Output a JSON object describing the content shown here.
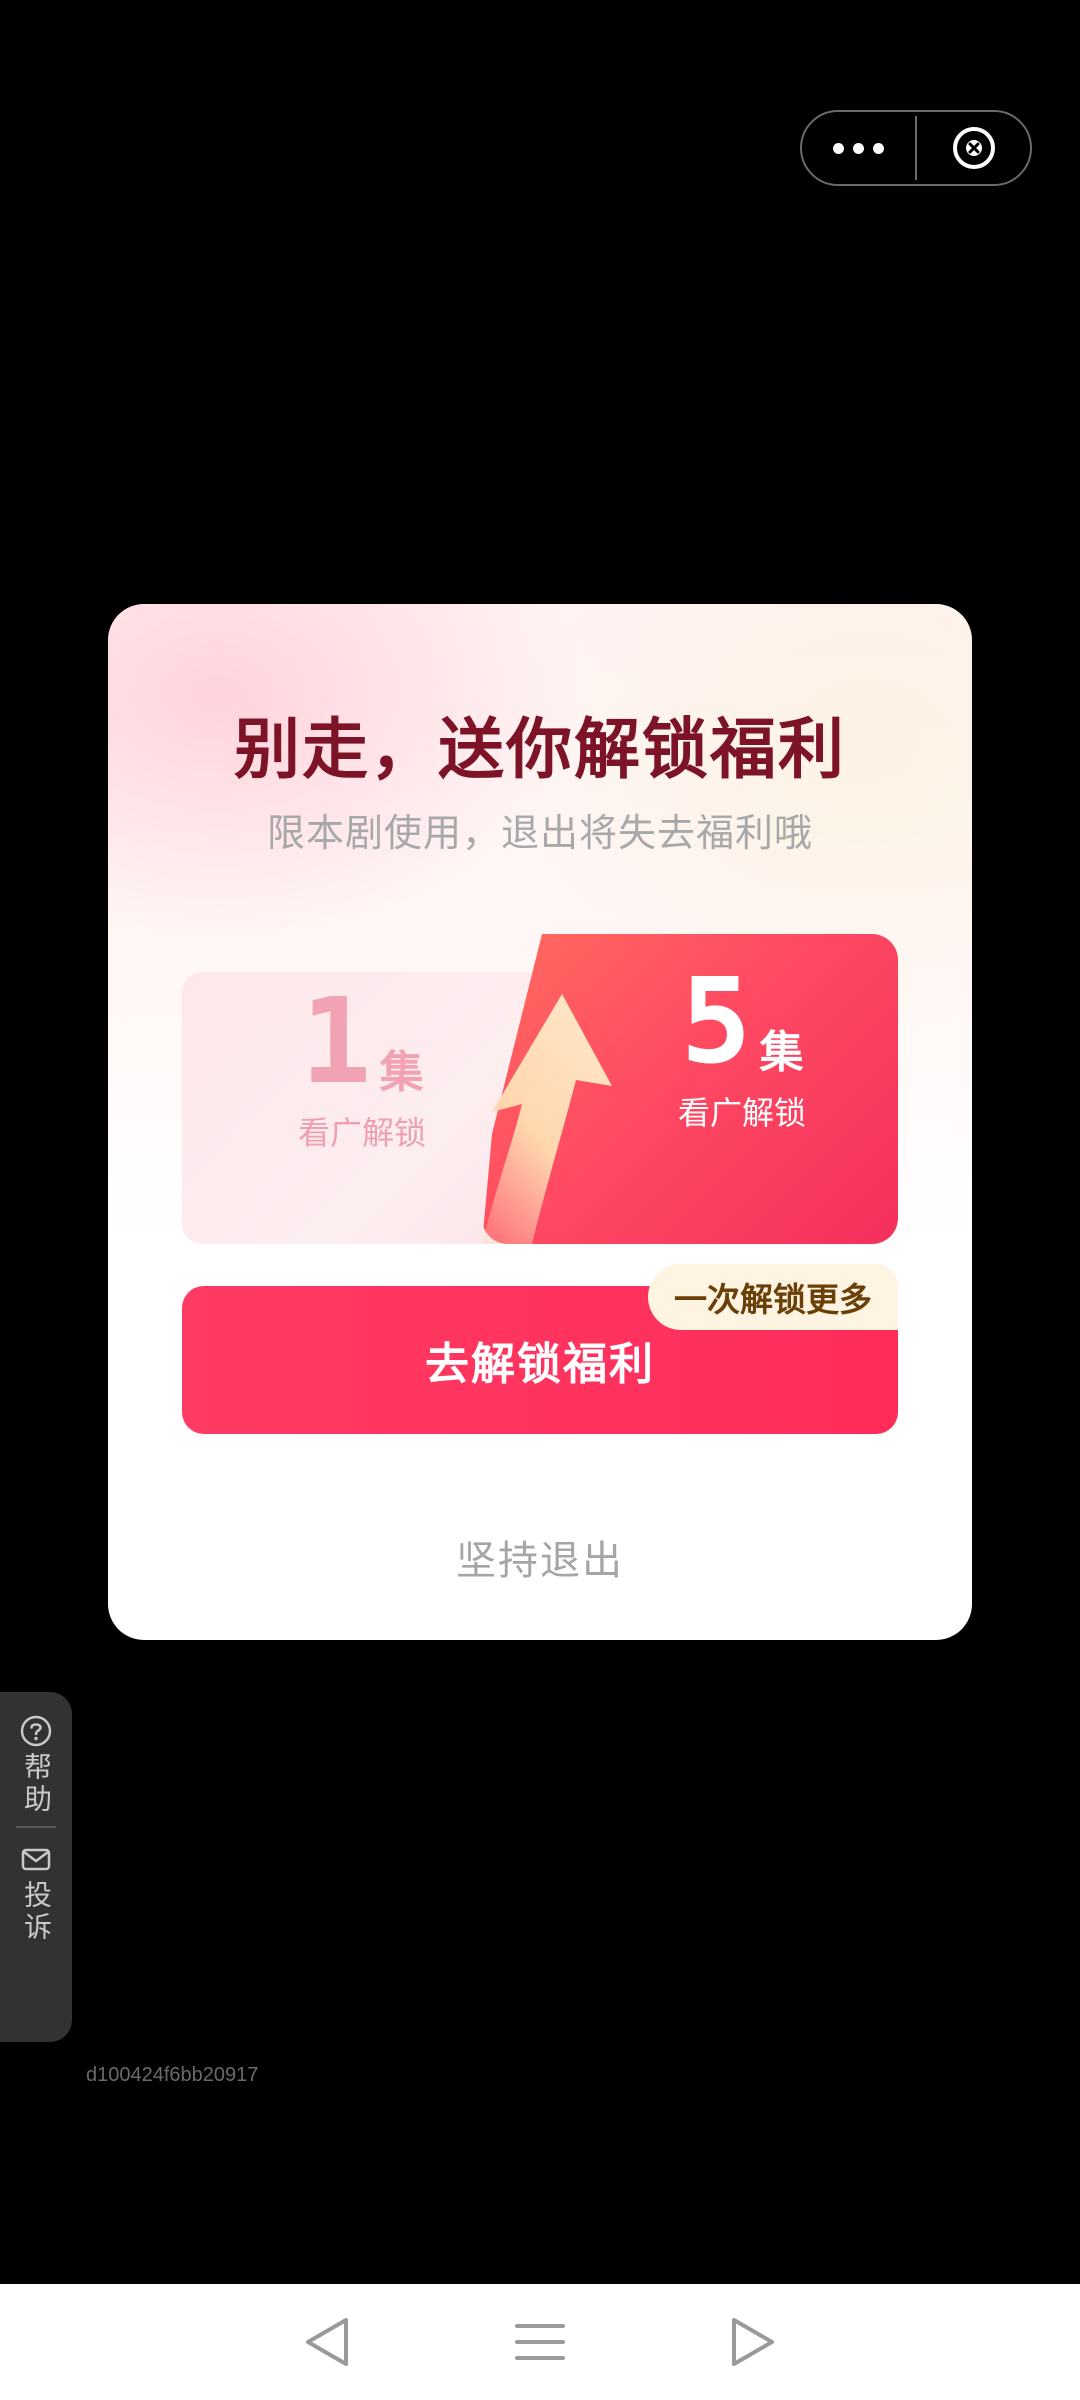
{
  "capsule": {
    "more_icon": "more-dots-icon",
    "close_icon": "close-circle-icon"
  },
  "modal": {
    "title": "别走，送你解锁福利",
    "subtitle": "限本剧使用，退出将失去福利哦",
    "compare": {
      "left": {
        "number": "1",
        "unit": "集",
        "caption": "看广解锁"
      },
      "right": {
        "number": "5",
        "unit": "集",
        "caption": "看广解锁"
      }
    },
    "badge": "一次解锁更多",
    "cta_label": "去解锁福利",
    "quit_label": "坚持退出"
  },
  "side_tab": {
    "help_label": "帮助",
    "complain_label": "投诉"
  },
  "trace_id": "d100424f6bb20917",
  "colors": {
    "accent": "#ff2c5a",
    "title": "#7d1327",
    "badge_bg": "#fff3e2"
  }
}
